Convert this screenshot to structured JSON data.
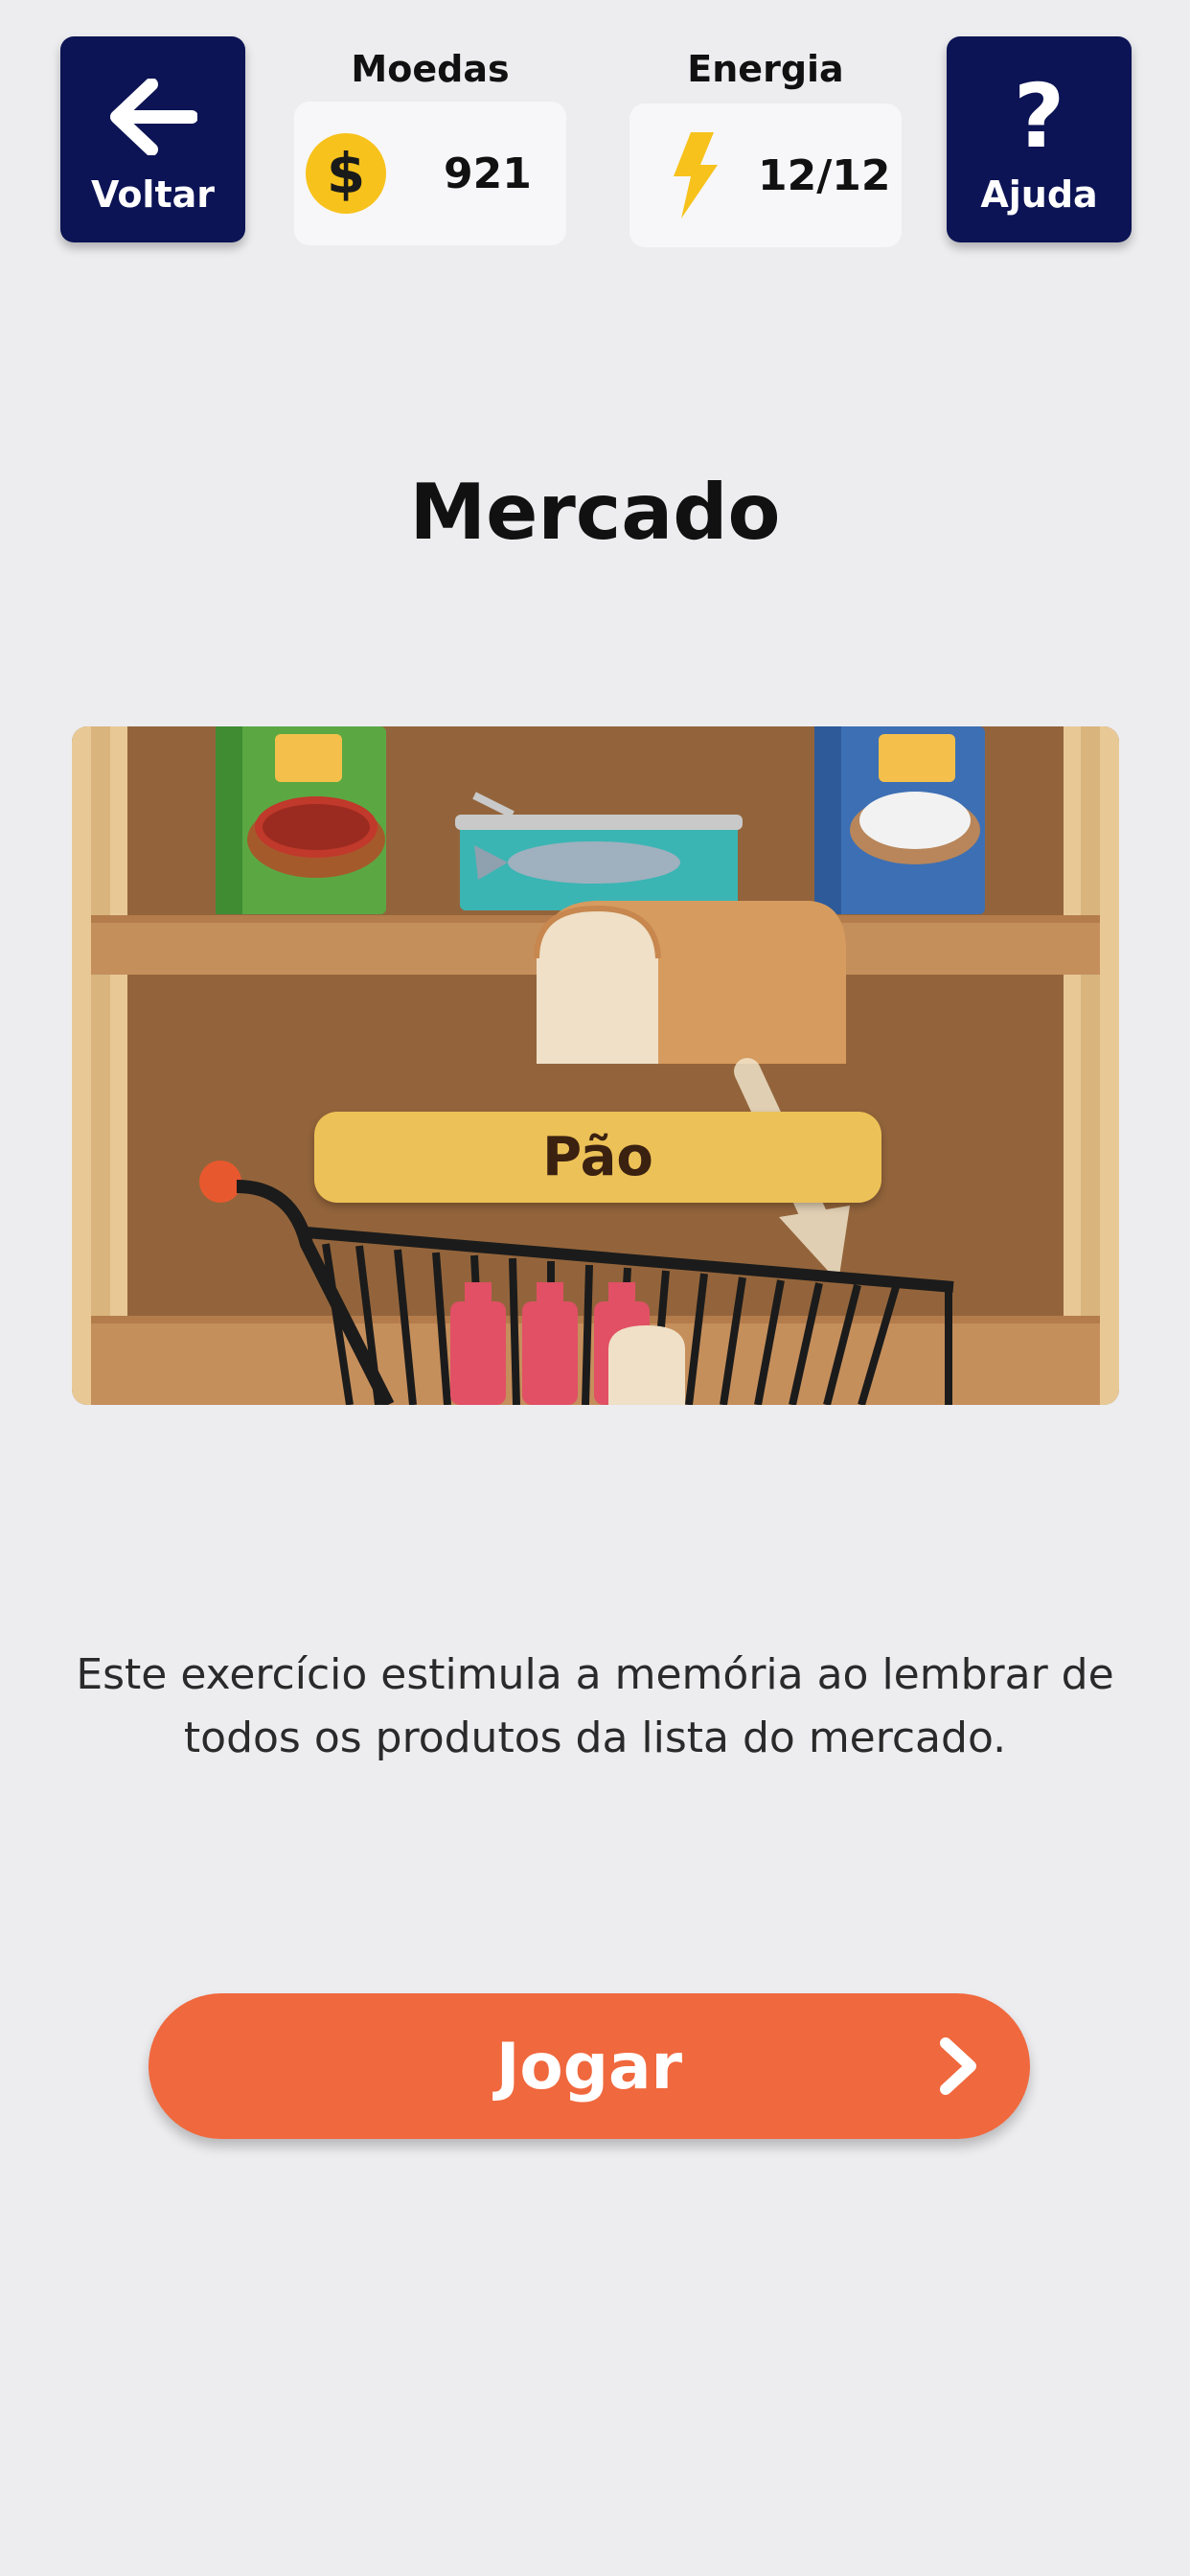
{
  "header": {
    "back_label": "Voltar",
    "help_label": "Ajuda",
    "help_glyph": "?",
    "coins_title": "Moedas",
    "coins_value": "921",
    "coin_symbol": "$",
    "energy_title": "Energia",
    "energy_value": "12/12"
  },
  "game": {
    "title": "Mercado",
    "illustration_item_label": "Pão",
    "description": "Este exercício estimula a memória ao lembrar de todos os produtos da lista do mercado.",
    "play_label": "Jogar"
  },
  "icons": {
    "back": "arrow-left-icon",
    "help": "question-mark-icon",
    "coin": "coin-icon",
    "energy": "lightning-bolt-icon",
    "play_chevron": "chevron-right-icon"
  },
  "colors": {
    "nav_button_bg": "#0c1455",
    "play_button_bg": "#f0683d",
    "coin": "#f7c21c",
    "bolt": "#f7c21c",
    "label_bg": "#ecc157",
    "page_bg": "#ededf0"
  }
}
